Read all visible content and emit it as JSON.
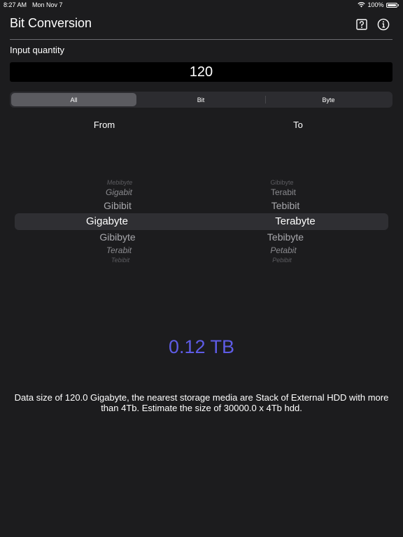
{
  "status_bar": {
    "time": "8:27 AM",
    "date": "Mon Nov 7",
    "battery": "100%"
  },
  "header": {
    "title": "Bit Conversion",
    "help_icon": "question-mark-box-icon",
    "info_icon": "info-circle-icon"
  },
  "input": {
    "label": "Input quantity",
    "value": "120"
  },
  "segments": {
    "all": "All",
    "bit": "Bit",
    "byte": "Byte",
    "selected": "All"
  },
  "columns": {
    "from": "From",
    "to": "To"
  },
  "from_picker": {
    "items": [
      "Mebibyte",
      "Gigabit",
      "Gibibit",
      "Gigabyte",
      "Gibibyte",
      "Terabit",
      "Tebibit"
    ],
    "selected": "Gigabyte"
  },
  "to_picker": {
    "items": [
      "Gibibyte",
      "Terabit",
      "Tebibit",
      "Terabyte",
      "Tebibyte",
      "Petabit",
      "Pebibit"
    ],
    "selected": "Terabyte"
  },
  "result": {
    "text": "0.12 TB"
  },
  "description": "Data size of 120.0 Gigabyte, the nearest storage media are Stack of External HDD with more than 4Tb. Estimate the size of 30000.0 x 4Tb hdd.",
  "colors": {
    "background": "#1c1c1e",
    "accent": "#5e5ce6",
    "input_bg": "#000000"
  }
}
